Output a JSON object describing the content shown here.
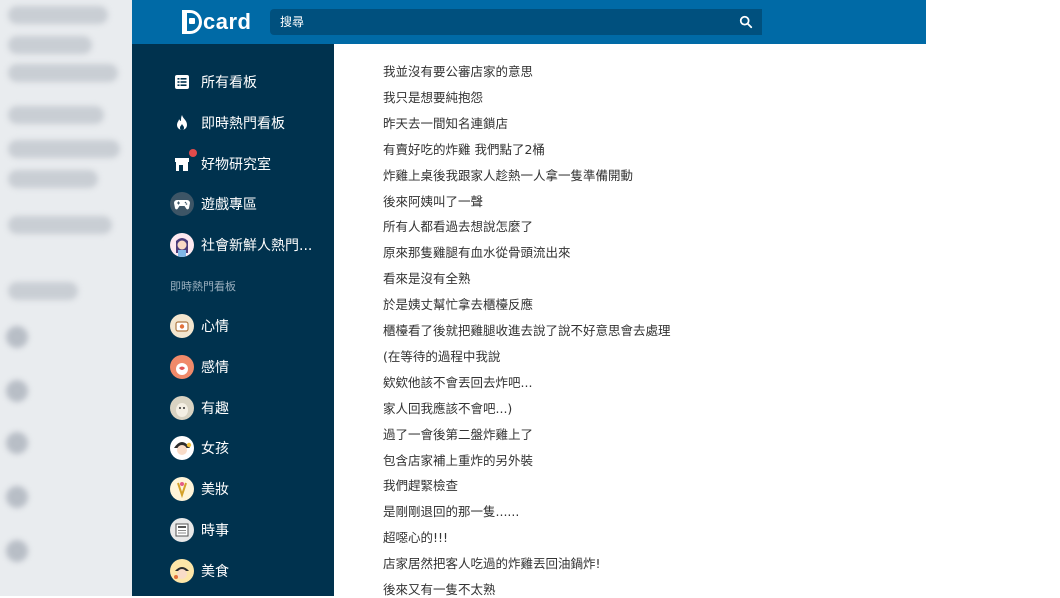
{
  "header": {
    "logo_text": "card",
    "search_placeholder": "搜尋",
    "colors": {
      "bar": "#006aa6",
      "search_bg": "#00507e"
    }
  },
  "sidebar": {
    "colors": {
      "bg": "#00324e",
      "text": "#ffffff",
      "section": "#9bb0bf"
    },
    "main_items": [
      {
        "label": "所有看板",
        "icon": "list-icon"
      },
      {
        "label": "即時熱門看板",
        "icon": "flame-icon"
      },
      {
        "label": "好物研究室",
        "icon": "store-icon"
      },
      {
        "label": "遊戲專區",
        "icon": "gamepad-icon"
      },
      {
        "label": "社會新鮮人熱門...",
        "icon": "avatar-icon"
      }
    ],
    "section_label": "即時熱門看板",
    "boards": [
      {
        "label": "心情"
      },
      {
        "label": "感情"
      },
      {
        "label": "有趣"
      },
      {
        "label": "女孩"
      },
      {
        "label": "美妝"
      },
      {
        "label": "時事"
      },
      {
        "label": "美食"
      }
    ]
  },
  "post": {
    "lines": [
      "我並沒有要公審店家的意思",
      "我只是想要純抱怨",
      "昨天去一間知名連鎖店",
      "有賣好吃的炸雞 我們點了2桶",
      "炸雞上桌後我跟家人趁熱一人拿一隻準備開動",
      "後來阿姨叫了一聲",
      "所有人都看過去想說怎麼了",
      "原來那隻雞腿有血水從骨頭流出來",
      "看來是沒有全熟",
      "於是姨丈幫忙拿去櫃檯反應",
      "櫃檯看了後就把雞腿收進去說了說不好意思會去處理",
      "(在等待的過程中我說",
      "欸欸他該不會丟回去炸吧...",
      "家人回我應該不會吧...)",
      "過了一會後第二盤炸雞上了",
      "包含店家補上重炸的另外裝",
      "我們趕緊檢查",
      "是剛剛退回的那一隻......",
      "超噁心的!!!",
      "店家居然把客人吃過的炸雞丟回油鍋炸!",
      "後來又有一隻不太熟"
    ]
  }
}
